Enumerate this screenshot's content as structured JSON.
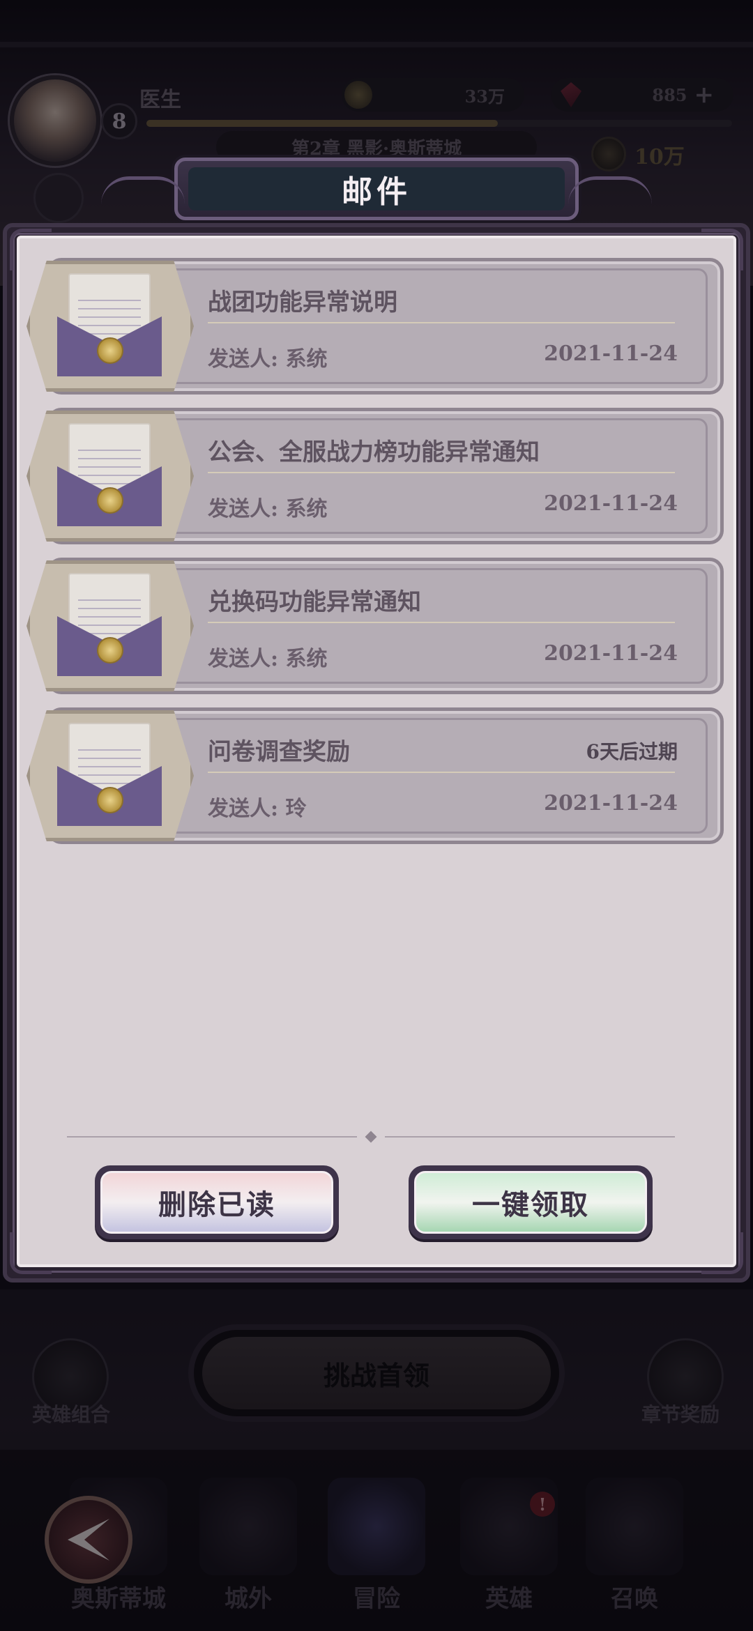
{
  "hud": {
    "player_name": "医生",
    "level": "8",
    "xp_progress": 0.6,
    "gold": "33万",
    "gems": "885",
    "gems_add": "+",
    "chapter": "第2章 黑影·奥斯蒂城",
    "power": "10万"
  },
  "dialog": {
    "title": "邮件",
    "mails": [
      {
        "title": "战团功能异常说明",
        "sender": "发送人: 系统",
        "date": "2021-11-24",
        "expire": ""
      },
      {
        "title": "公会、全服战力榜功能异常通知",
        "sender": "发送人: 系统",
        "date": "2021-11-24",
        "expire": ""
      },
      {
        "title": "兑换码功能异常通知",
        "sender": "发送人: 系统",
        "date": "2021-11-24",
        "expire": ""
      },
      {
        "title": "问卷调查奖励",
        "sender": "发送人: 玲",
        "date": "2021-11-24",
        "expire": "6天后过期"
      }
    ],
    "delete_read_label": "删除已读",
    "claim_all_label": "一键领取"
  },
  "stage": {
    "challenge_boss_label": "挑战首领",
    "hero_combo_label": "英雄组合",
    "chapter_reward_label": "章节奖励"
  },
  "nav": {
    "items": [
      {
        "label": "奥斯蒂城"
      },
      {
        "label": "城外"
      },
      {
        "label": "冒险"
      },
      {
        "label": "英雄"
      },
      {
        "label": "召唤"
      }
    ],
    "hero_badge": "!"
  },
  "colors": {
    "paper": "#d9d1d5",
    "mail_card": "#b5adb5",
    "frame": "#2a2230",
    "delete_button": "#c4c3e0",
    "claim_button": "#a6d6b2"
  }
}
